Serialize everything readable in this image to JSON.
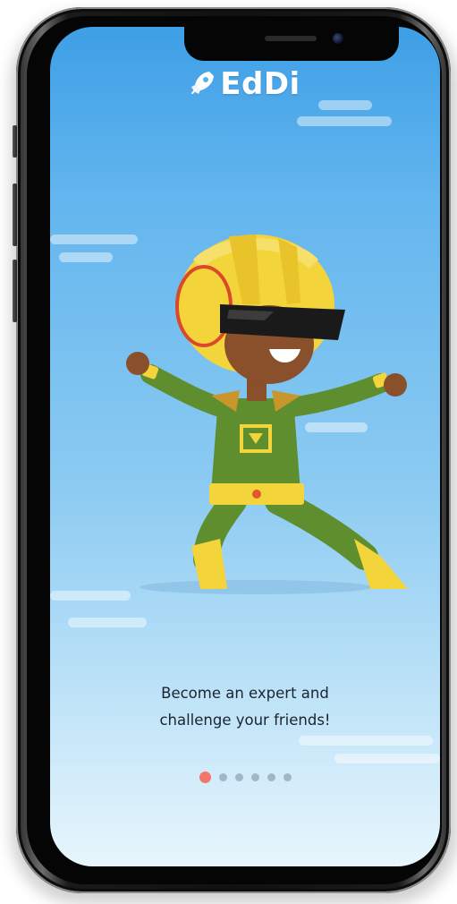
{
  "app": {
    "logo_text": "EdDi",
    "logo_icon": "rocket-icon",
    "brand_color": "#ffffff"
  },
  "onboarding": {
    "caption_line1": "Become an expert and",
    "caption_line2": "challenge your friends!",
    "illustration": "superhero-kid-character",
    "pager": {
      "total": 6,
      "active_index": 0,
      "active_color": "#f2776a",
      "inactive_color": "#9fb8c8"
    }
  },
  "colors": {
    "sky_top": "#3e9fe6",
    "sky_bottom": "#e8f6fc",
    "text": "#1c2430"
  }
}
